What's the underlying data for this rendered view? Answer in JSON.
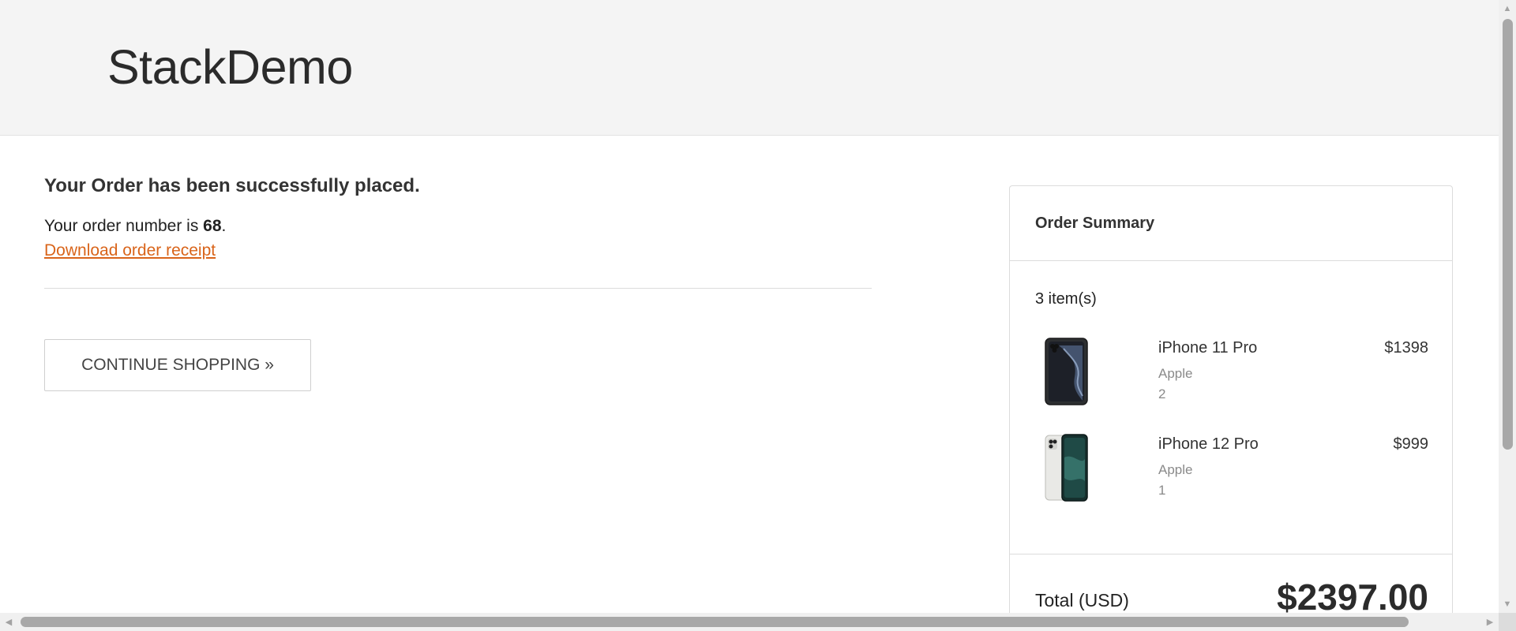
{
  "header": {
    "logo_text": "StackDemo"
  },
  "confirmation": {
    "title": "Your Order has been successfully placed.",
    "order_prefix": "Your order number is ",
    "order_number": "68",
    "order_suffix": ".",
    "receipt_link": "Download order receipt",
    "continue_label": "CONTINUE SHOPPING »"
  },
  "summary": {
    "title": "Order Summary",
    "item_count": "3 item(s)",
    "items": [
      {
        "name": "iPhone 11 Pro",
        "brand": "Apple",
        "quantity": "2",
        "price": "$1398",
        "thumb_icon": "iphone-11-pro-image"
      },
      {
        "name": "iPhone 12 Pro",
        "brand": "Apple",
        "quantity": "1",
        "price": "$999",
        "thumb_icon": "iphone-12-pro-image"
      }
    ],
    "total_label": "Total (USD)",
    "total_value": "$2397.00"
  },
  "colors": {
    "header_bg": "#f4f4f4",
    "link": "#d9641a",
    "text": "#333333",
    "muted": "#8a8a8a",
    "border": "#dcdcdc"
  },
  "icons": {
    "scroll_up": "scroll-up-arrow-icon",
    "scroll_down": "scroll-down-arrow-icon",
    "scroll_left": "scroll-left-arrow-icon",
    "scroll_right": "scroll-right-arrow-icon"
  }
}
